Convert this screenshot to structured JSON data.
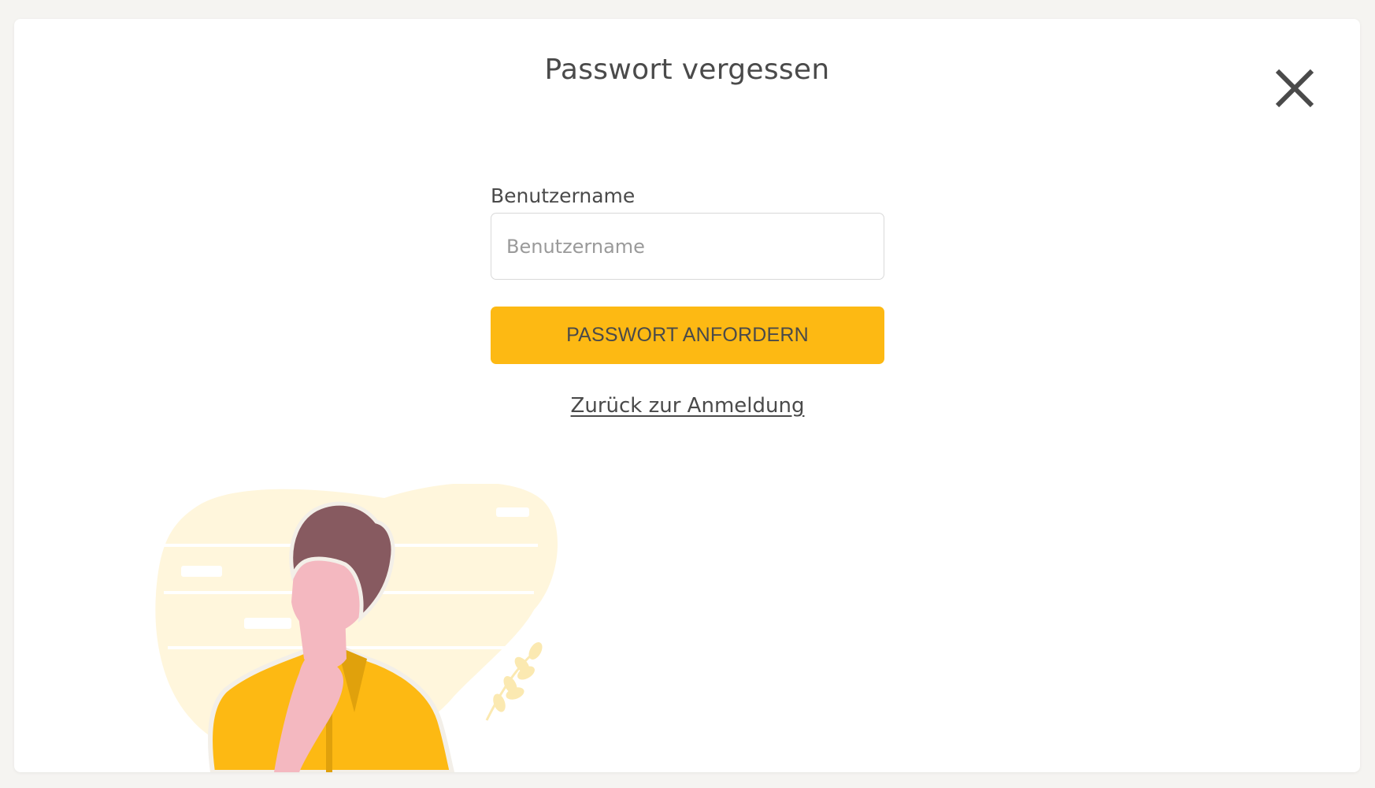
{
  "dialog": {
    "title": "Passwort vergessen",
    "close_icon": "close-icon"
  },
  "form": {
    "username_label": "Benutzername",
    "username_value": "",
    "username_placeholder": "Benutzername",
    "submit_label": "PASSWORT ANFORDERN",
    "back_link": "Zurück zur Anmeldung"
  },
  "illustration": {
    "icon": "thinking-person-illustration"
  },
  "colors": {
    "accent": "#fdb913",
    "text": "#4a4a4a",
    "background": "#f5f4f1",
    "card": "#ffffff",
    "blob": "#fff6dc",
    "hair": "#875a60",
    "skin": "#f4b8c0",
    "shirt": "#fdb913",
    "shirt_shadow": "#e0a10c"
  }
}
